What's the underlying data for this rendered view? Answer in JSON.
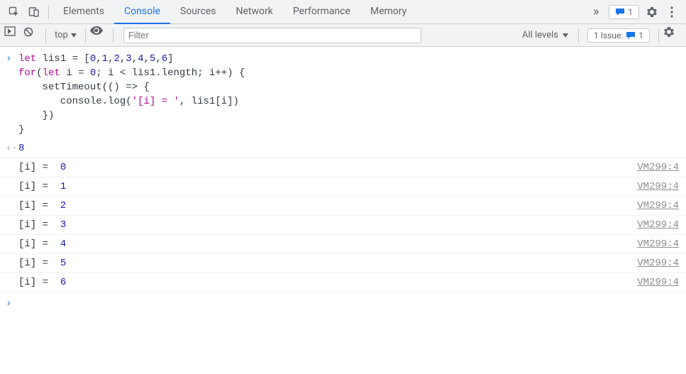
{
  "topbar": {
    "tabs": [
      "Elements",
      "Console",
      "Sources",
      "Network",
      "Performance",
      "Memory"
    ],
    "active_tab": "Console",
    "messages_badge": "1"
  },
  "subbar": {
    "context": "top",
    "filter_placeholder": "Filter",
    "filter_value": "",
    "levels_label": "All levels",
    "issues_prefix": "1 Issue:",
    "issues_count": "1"
  },
  "input_code_lines": [
    [
      {
        "cls": "kw",
        "t": "let"
      },
      {
        "t": " lis1 = ["
      },
      {
        "cls": "num",
        "t": "0"
      },
      {
        "t": ","
      },
      {
        "cls": "num",
        "t": "1"
      },
      {
        "t": ","
      },
      {
        "cls": "num",
        "t": "2"
      },
      {
        "t": ","
      },
      {
        "cls": "num",
        "t": "3"
      },
      {
        "t": ","
      },
      {
        "cls": "num",
        "t": "4"
      },
      {
        "t": ","
      },
      {
        "cls": "num",
        "t": "5"
      },
      {
        "t": ","
      },
      {
        "cls": "num",
        "t": "6"
      },
      {
        "t": "]"
      }
    ],
    [
      {
        "cls": "kw",
        "t": "for"
      },
      {
        "t": "("
      },
      {
        "cls": "kw",
        "t": "let"
      },
      {
        "t": " i = "
      },
      {
        "cls": "num",
        "t": "0"
      },
      {
        "t": "; i < lis1.length; i++) {"
      }
    ],
    [
      {
        "t": "    setTimeout(() => {"
      }
    ],
    [
      {
        "t": "       console.log("
      },
      {
        "cls": "str",
        "t": "'[i] = '"
      },
      {
        "t": ", lis1[i])"
      }
    ],
    [
      {
        "t": "    })"
      }
    ],
    [
      {
        "t": "}"
      }
    ]
  ],
  "result_value": "8",
  "log_rows": [
    {
      "label": "[i] =  ",
      "value": "0",
      "source": "VM299:4"
    },
    {
      "label": "[i] =  ",
      "value": "1",
      "source": "VM299:4"
    },
    {
      "label": "[i] =  ",
      "value": "2",
      "source": "VM299:4"
    },
    {
      "label": "[i] =  ",
      "value": "3",
      "source": "VM299:4"
    },
    {
      "label": "[i] =  ",
      "value": "4",
      "source": "VM299:4"
    },
    {
      "label": "[i] =  ",
      "value": "5",
      "source": "VM299:4"
    },
    {
      "label": "[i] =  ",
      "value": "6",
      "source": "VM299:4"
    }
  ]
}
